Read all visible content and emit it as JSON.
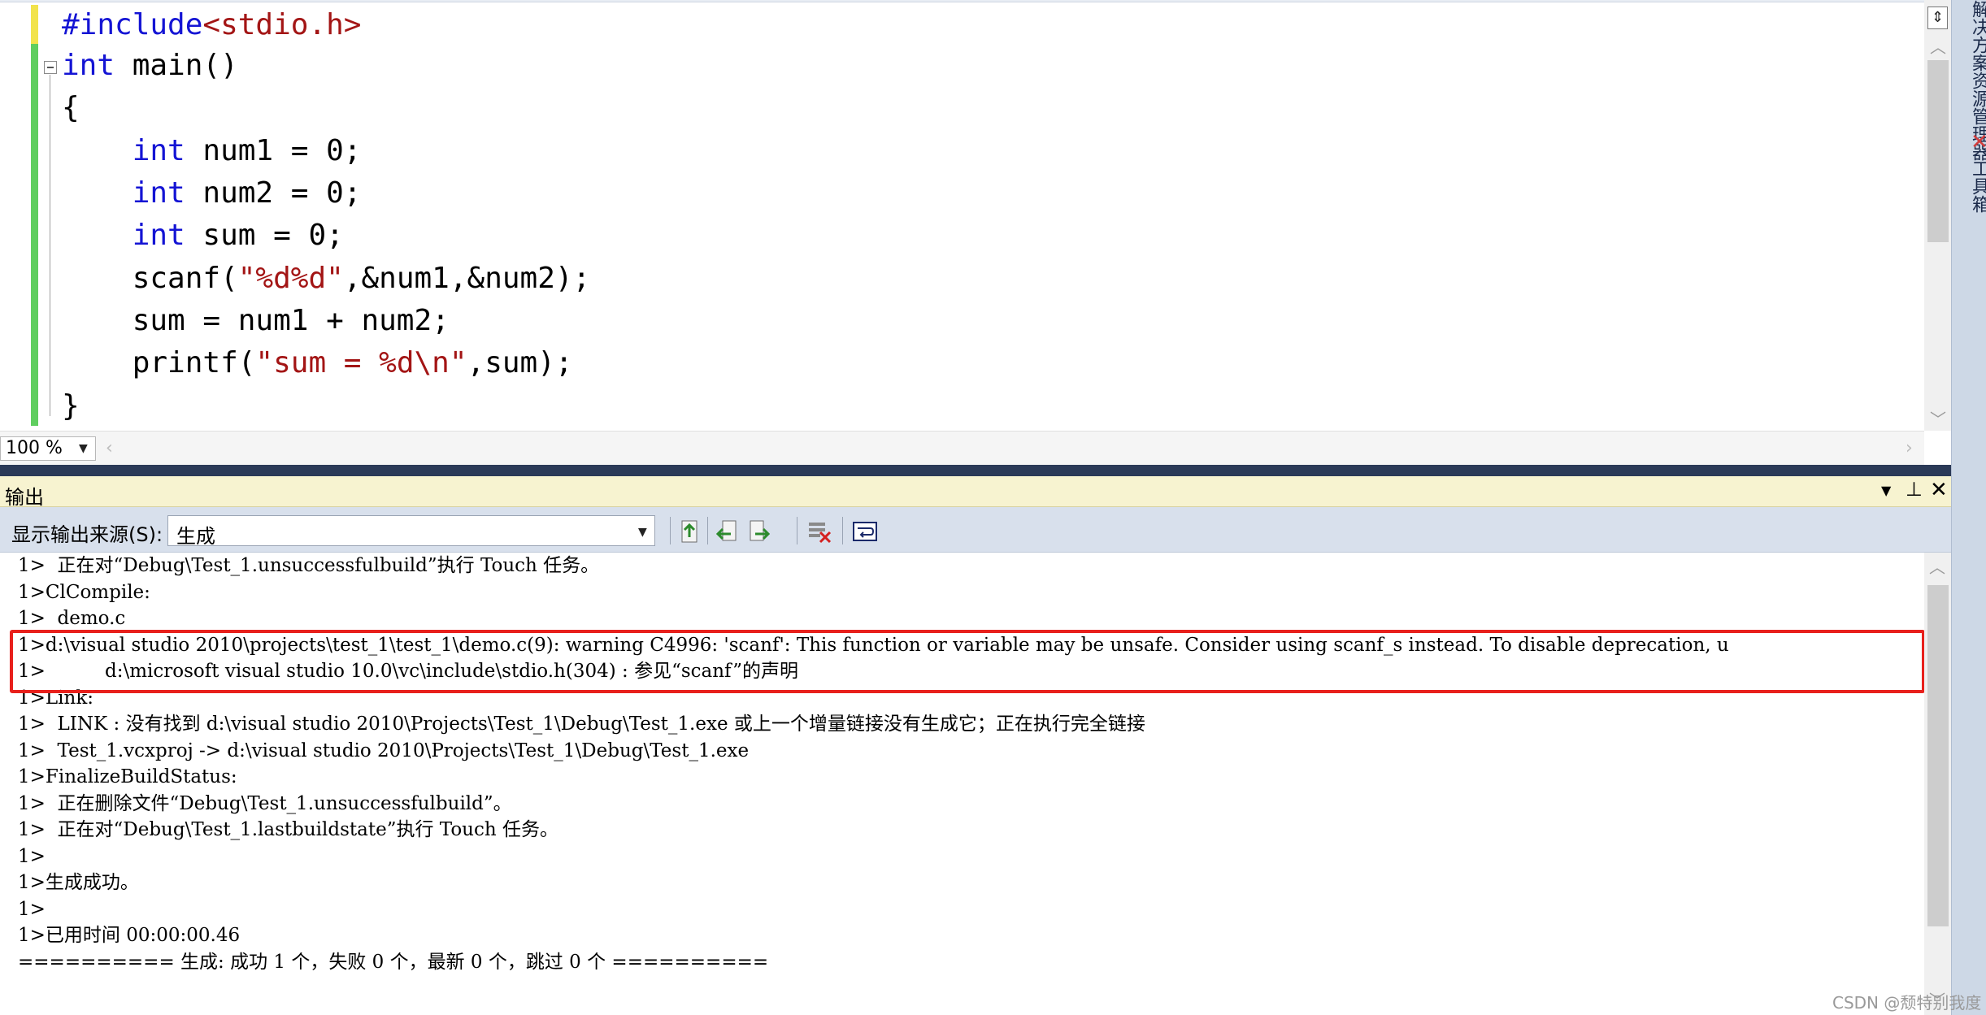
{
  "editor": {
    "code_lines": [
      [
        {
          "t": "#include",
          "c": "pp"
        },
        {
          "t": "<stdio.h>",
          "c": "str"
        }
      ],
      [
        {
          "t": "int",
          "c": "kw"
        },
        {
          "t": " main()",
          "c": ""
        }
      ],
      [
        {
          "t": "{",
          "c": ""
        }
      ],
      [
        {
          "t": "    ",
          "c": ""
        },
        {
          "t": "int",
          "c": "kw"
        },
        {
          "t": " num1 = 0;",
          "c": ""
        }
      ],
      [
        {
          "t": "    ",
          "c": ""
        },
        {
          "t": "int",
          "c": "kw"
        },
        {
          "t": " num2 = 0;",
          "c": ""
        }
      ],
      [
        {
          "t": "    ",
          "c": ""
        },
        {
          "t": "int",
          "c": "kw"
        },
        {
          "t": " sum = 0;",
          "c": ""
        }
      ],
      [
        {
          "t": "    scanf(",
          "c": ""
        },
        {
          "t": "\"%d%d\"",
          "c": "str"
        },
        {
          "t": ",&num1,&num2);",
          "c": ""
        }
      ],
      [
        {
          "t": "    sum = num1 + num2;",
          "c": ""
        }
      ],
      [
        {
          "t": "    printf(",
          "c": ""
        },
        {
          "t": "\"sum = %d\\n\"",
          "c": "str"
        },
        {
          "t": ",sum);",
          "c": ""
        }
      ],
      [
        {
          "t": "}",
          "c": ""
        }
      ]
    ],
    "zoom": "100 %"
  },
  "right_rail": {
    "solution_explorer": "解决方案资源管理器",
    "toolbox": "工具箱"
  },
  "output": {
    "title": "输出",
    "source_label": "显示输出来源(S):",
    "source_value": "生成",
    "lines": [
      "1>  正在对“Debug\\Test_1.unsuccessfulbuild”执行 Touch 任务。",
      "1>ClCompile:",
      "1>  demo.c",
      "1>d:\\visual studio 2010\\projects\\test_1\\test_1\\demo.c(9): warning C4996: 'scanf': This function or variable may be unsafe. Consider using scanf_s instead. To disable deprecation, u",
      "1>          d:\\microsoft visual studio 10.0\\vc\\include\\stdio.h(304) : 参见“scanf”的声明",
      "1>Link:",
      "1>  LINK : 没有找到 d:\\visual studio 2010\\Projects\\Test_1\\Debug\\Test_1.exe 或上一个增量链接没有生成它；正在执行完全链接",
      "1>  Test_1.vcxproj -> d:\\visual studio 2010\\Projects\\Test_1\\Debug\\Test_1.exe",
      "1>FinalizeBuildStatus:",
      "1>  正在删除文件“Debug\\Test_1.unsuccessfulbuild”。",
      "1>  正在对“Debug\\Test_1.lastbuildstate”执行 Touch 任务。",
      "1>",
      "1>生成成功。",
      "1>",
      "1>已用时间 00:00:00.46",
      "========== 生成: 成功 1 个，失败 0 个，最新 0 个，跳过 0 个 =========="
    ]
  },
  "watermark": "CSDN @颓特别我度",
  "colors": {
    "keyword": "#1414d4",
    "string": "#a31515",
    "highlight_box": "#e8201c",
    "change_bar_saved": "#5fce5f",
    "change_bar_unsaved": "#f2e34b"
  }
}
